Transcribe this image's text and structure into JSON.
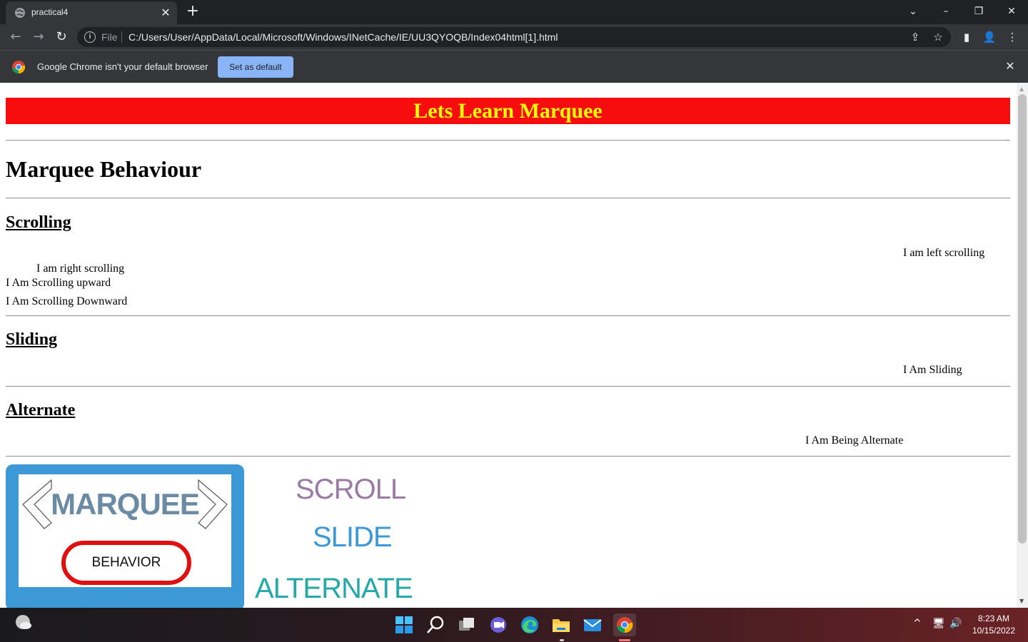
{
  "browser": {
    "tab_title": "practical4",
    "tab_close_glyph": "✕",
    "new_tab_glyph": "+",
    "window_controls": {
      "list": "⌄",
      "minimize": "–",
      "restore": "❐",
      "close": "✕"
    },
    "nav": {
      "back": "←",
      "forward": "→",
      "reload": "↻"
    },
    "address": {
      "info_glyph": "i",
      "scheme": "File",
      "url": "C:/Users/User/AppData/Local/Microsoft/Windows/INetCache/IE/UU3QYOQB/Index04html[1].html",
      "share_glyph": "⇪",
      "bookmark_glyph": "☆"
    },
    "toolbar_icons": {
      "side_panel": "▮",
      "profile": "👤",
      "menu": "⋮"
    },
    "infobar": {
      "message": "Google Chrome isn't your default browser",
      "button": "Set as default",
      "close_glyph": "✕"
    }
  },
  "page": {
    "banner": "Lets Learn Marquee",
    "heading": "Marquee Behaviour",
    "scrolling": {
      "title": "Scrolling",
      "left_text": "I am left scrolling",
      "right_text": "I am right scrolling",
      "up_text": "I Am Scrolling upward",
      "down_text": "I Am Scrolling Downward"
    },
    "sliding": {
      "title": "Sliding",
      "text": "I Am Sliding"
    },
    "alternate": {
      "title": "Alternate",
      "text": "I Am Being Alternate"
    },
    "logo": {
      "word": "MARQUEE",
      "pill": "BEHAVIOR"
    },
    "words": {
      "scroll": "SCROLL",
      "slide": "SLIDE",
      "alternate": "ALTERNATE"
    },
    "colors": {
      "banner_bg": "#f70d0d",
      "banner_text": "#ffff00",
      "logo_bg": "#3d99d6",
      "scroll_word": "#9b7aa3",
      "slide_word": "#3d99d6",
      "alternate_word": "#26a9a6"
    }
  },
  "taskbar": {
    "time": "8:23 AM",
    "date": "10/15/2022",
    "tray": {
      "caret": "^",
      "network": "🖥",
      "volume": "🔊"
    },
    "apps": [
      "weather-icon",
      "windows-start-icon",
      "search-icon",
      "task-view-icon",
      "teams-chat-icon",
      "edge-icon",
      "file-explorer-icon",
      "mail-icon",
      "chrome-icon"
    ]
  }
}
